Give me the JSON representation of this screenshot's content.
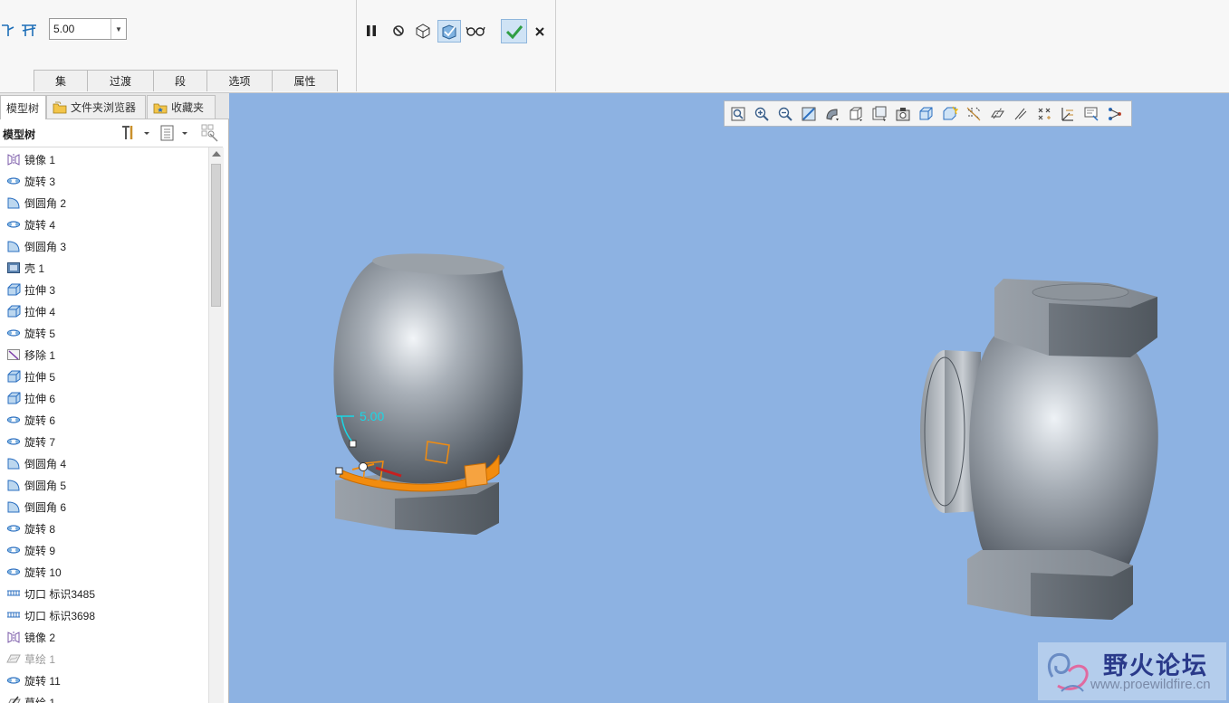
{
  "dashboard": {
    "value_field": "5.00",
    "tabs": [
      "集",
      "过渡",
      "段",
      "选项",
      "属性"
    ],
    "actions": [
      "pause-icon",
      "no-preview-icon",
      "geometry-preview-icon",
      "verify-icon",
      "glasses-icon",
      "ok-check-icon",
      "cancel-x-icon"
    ]
  },
  "left_pane": {
    "tabs": [
      {
        "label": "模型树",
        "icon": "model-tree-icon",
        "active": true
      },
      {
        "label": "文件夹浏览器",
        "icon": "folder-browser-icon",
        "active": false
      },
      {
        "label": "收藏夹",
        "icon": "favorites-icon",
        "active": false
      }
    ],
    "tree_title": "模型树",
    "tree_items": [
      {
        "label": "镜像 1",
        "icon": "mirror"
      },
      {
        "label": "旋转 3",
        "icon": "revolve"
      },
      {
        "label": "倒圆角 2",
        "icon": "round"
      },
      {
        "label": "旋转 4",
        "icon": "revolve"
      },
      {
        "label": "倒圆角 3",
        "icon": "round"
      },
      {
        "label": "壳 1",
        "icon": "shell"
      },
      {
        "label": "拉伸 3",
        "icon": "extrude"
      },
      {
        "label": "拉伸 4",
        "icon": "extrude"
      },
      {
        "label": "旋转 5",
        "icon": "revolve"
      },
      {
        "label": "移除 1",
        "icon": "remove"
      },
      {
        "label": "拉伸 5",
        "icon": "extrude"
      },
      {
        "label": "拉伸 6",
        "icon": "extrude"
      },
      {
        "label": "旋转 6",
        "icon": "revolve"
      },
      {
        "label": "旋转 7",
        "icon": "revolve"
      },
      {
        "label": "倒圆角 4",
        "icon": "round"
      },
      {
        "label": "倒圆角 5",
        "icon": "round"
      },
      {
        "label": "倒圆角 6",
        "icon": "round"
      },
      {
        "label": "旋转 8",
        "icon": "revolve"
      },
      {
        "label": "旋转 9",
        "icon": "revolve"
      },
      {
        "label": "旋转 10",
        "icon": "revolve"
      },
      {
        "label": "切口 标识3485",
        "icon": "cut"
      },
      {
        "label": "切口 标识3698",
        "icon": "cut"
      },
      {
        "label": "镜像 2",
        "icon": "mirror"
      },
      {
        "label": "草绘 1",
        "icon": "sketch",
        "dimmed": true
      },
      {
        "label": "旋转 11",
        "icon": "revolve"
      },
      {
        "label": "草绘 1",
        "icon": "sketch-edit"
      }
    ]
  },
  "viewport": {
    "background": "#8db2e2",
    "round_dimension": "5.00",
    "view_toolbar": [
      "refit-icon",
      "zoom-in-icon",
      "zoom-out-icon",
      "repaint-icon",
      "display-style-icon",
      "saved-orientations-icon",
      "view-manager-icon",
      "perspective-icon",
      "spin-center-icon",
      "annotation-display-icon",
      "plane-display-icon",
      "axis-display-icon",
      "point-display-icon",
      "csys-display-icon",
      "annotation-filter-icon",
      "model-analysis-icon"
    ],
    "watermark": {
      "title": "野火论坛",
      "url": "www.proewildfire.cn"
    }
  },
  "colors": {
    "accent": "#2b8fd6",
    "check": "#2f9e44",
    "highlight": "#f28c0f",
    "dimension": "#19d7e6"
  }
}
